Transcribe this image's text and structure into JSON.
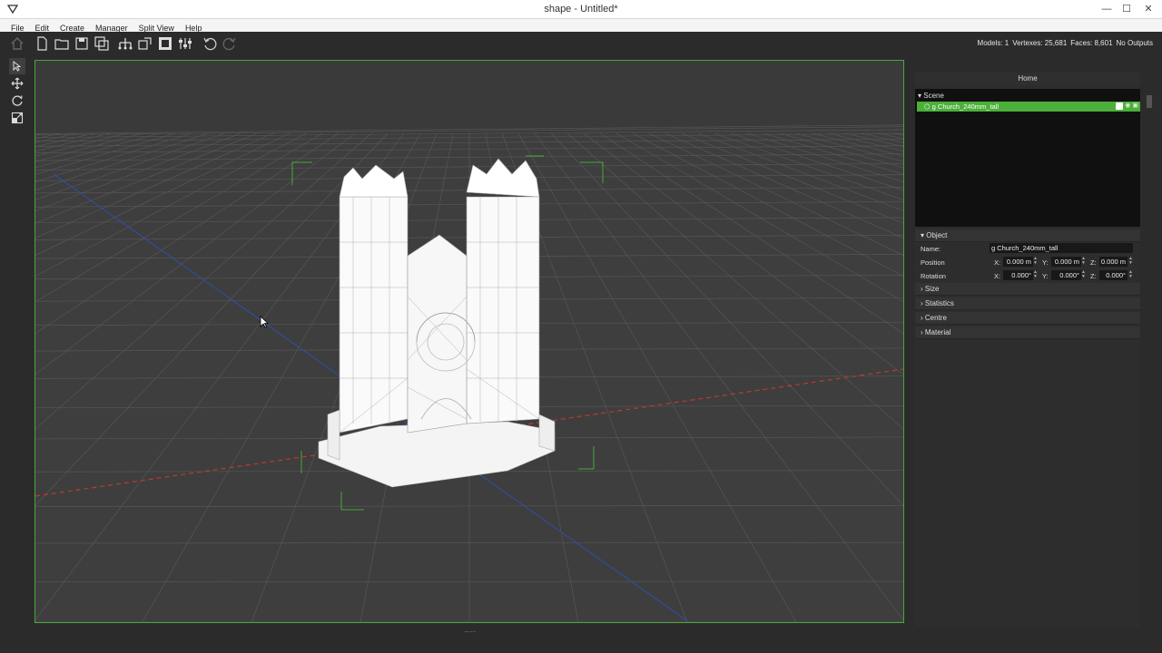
{
  "window": {
    "title": "shape - Untitled*"
  },
  "menu": [
    "File",
    "Edit",
    "Create",
    "Manager",
    "Split View",
    "Help"
  ],
  "stats": {
    "models": "Models: 1",
    "vertexes": "Vertexes: 25,681",
    "faces": "Faces: 8,601",
    "outputs": "No Outputs"
  },
  "panel": {
    "header": "Home",
    "scene_label": "Scene",
    "scene_item": "g Church_240mm_tall",
    "object_label": "Object",
    "name_label": "Name:",
    "name_value": "g Church_240mm_tall",
    "position_label": "Position",
    "rotation_label": "Rotation",
    "axes": [
      "X:",
      "Y:",
      "Z:"
    ],
    "position": [
      "0.000 m",
      "0.000 m",
      "0.000 m"
    ],
    "rotation": [
      "0.000°",
      "0.000°",
      "0.000°"
    ],
    "sections": [
      "Size",
      "Statistics",
      "Centre",
      "Material"
    ]
  },
  "colors": {
    "accent_green": "#4caf3a",
    "viewport_border": "#47a83a",
    "x_axis": "#c0392b",
    "z_axis": "#2f4fb0"
  },
  "icons": {
    "toolbar": [
      "home-icon",
      "new-file-icon",
      "open-folder-icon",
      "save-icon",
      "save-as-icon",
      "hierarchy-icon",
      "import-icon",
      "export-icon",
      "settings-icon",
      "undo-icon",
      "redo-icon"
    ],
    "tools": [
      "select-icon",
      "move-icon",
      "rotate-icon",
      "scale-icon"
    ]
  }
}
